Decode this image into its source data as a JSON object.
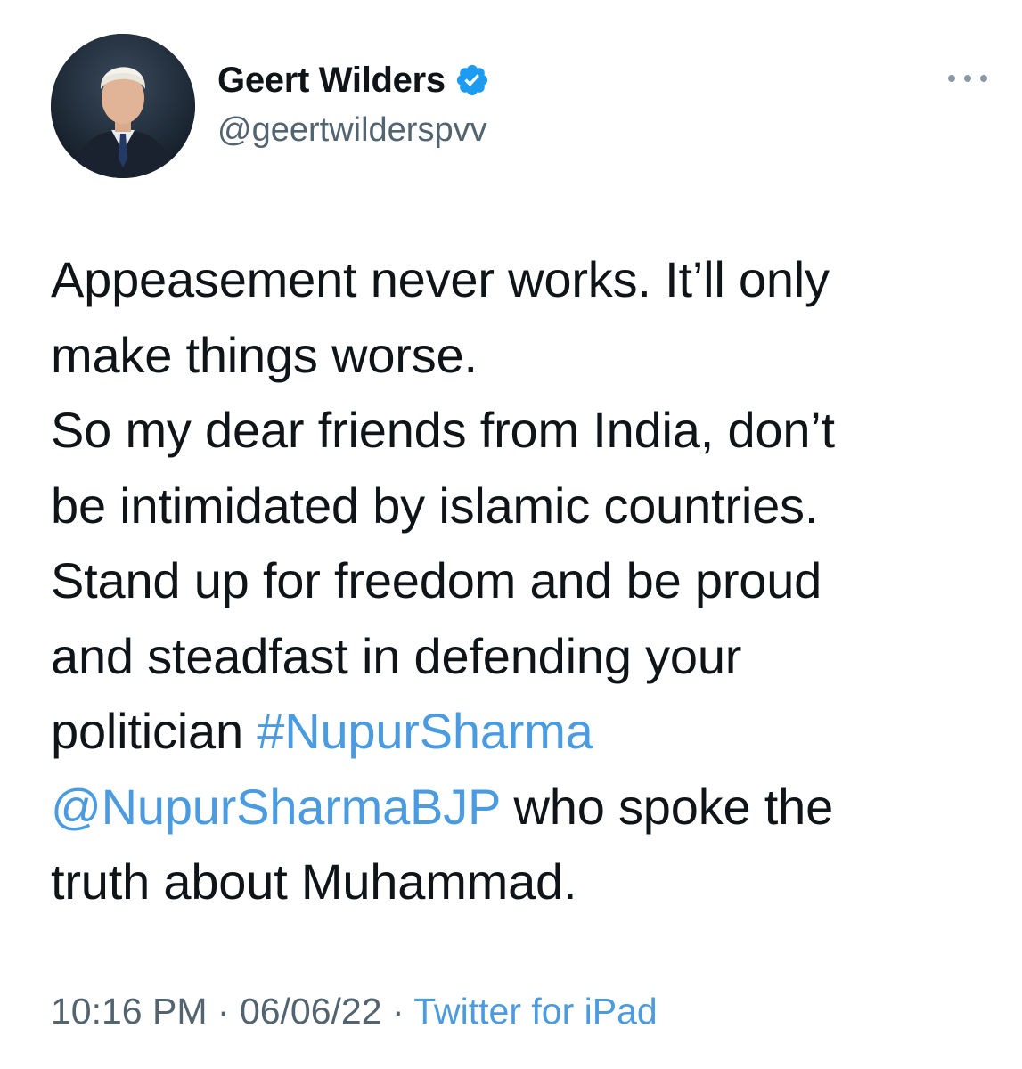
{
  "author": {
    "display_name": "Geert Wilders",
    "handle": "@geertwilderspvv",
    "verified": true,
    "verified_icon": "verified-badge-icon",
    "avatar": "profile-photo"
  },
  "more_icon": "more-options-icon",
  "tweet": {
    "line1": "Appeasement never works. It’ll only",
    "line2": "make things worse.",
    "line3": "So my dear friends from India, don’t",
    "line4": "be intimidated by islamic countries.",
    "line5": "Stand up for freedom and be proud",
    "line6": "and steadfast in defending your",
    "line7_prefix": "politician ",
    "hashtag": "#NupurSharma",
    "mention": "@NupurSharmaBJP",
    "line8_suffix": " who spoke the",
    "line9": "truth about Muhammad."
  },
  "meta": {
    "time": "10:16 PM",
    "separator": " · ",
    "date": "06/06/22",
    "source": "Twitter for iPad"
  },
  "colors": {
    "text": "#0f1419",
    "secondary": "#536471",
    "link": "#4a9be0",
    "verified": "#1d9bf0"
  }
}
